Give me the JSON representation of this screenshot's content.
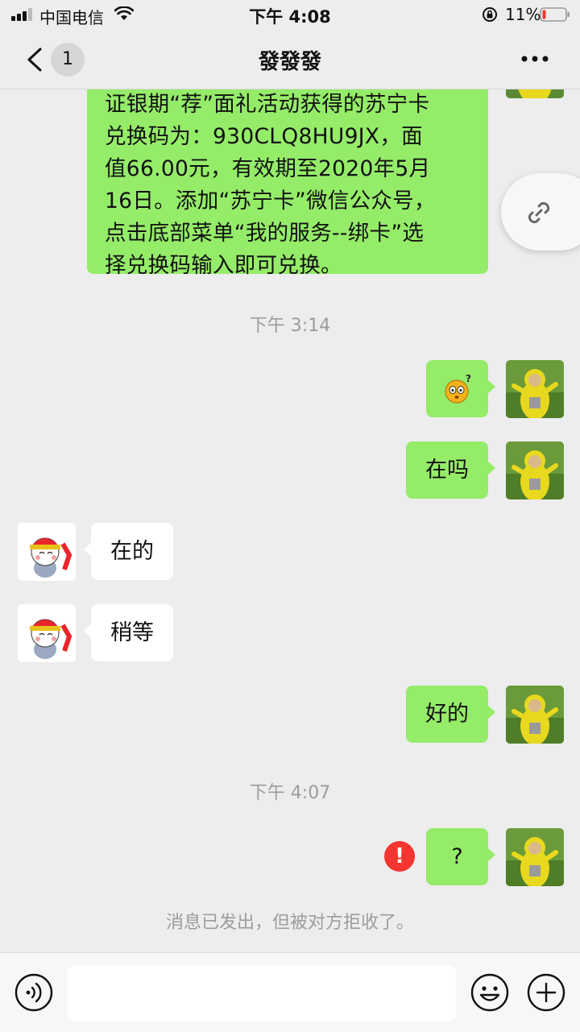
{
  "status_bar": {
    "carrier": "中国电信",
    "time": "下午 4:08",
    "battery": "11%"
  },
  "nav": {
    "unread_count": "1",
    "title": "發發發"
  },
  "chat": {
    "top_message": {
      "lines": [
        "证银期“荐”面礼活动获得的苏宁卡",
        "兑换码为：930CLQ8HU9JX，面",
        "值66.00元，有效期至2020年5月",
        "16日。添加“苏宁卡”微信公众号，",
        "点击底部菜单“我的服务--绑卡”选",
        "择兑换码输入即可兑换。"
      ]
    },
    "timestamp_1": "下午 3:14",
    "msg_in_1": "在的",
    "msg_in_2": "稍等",
    "msg_out_2": "在吗",
    "msg_out_3": "好的",
    "timestamp_2": "下午 4:07",
    "msg_out_4": "?",
    "system_notice": "消息已发出，但被对方拒收了。"
  },
  "icons": {
    "accent_green": "#95ec69",
    "error_red": "#f43530"
  }
}
